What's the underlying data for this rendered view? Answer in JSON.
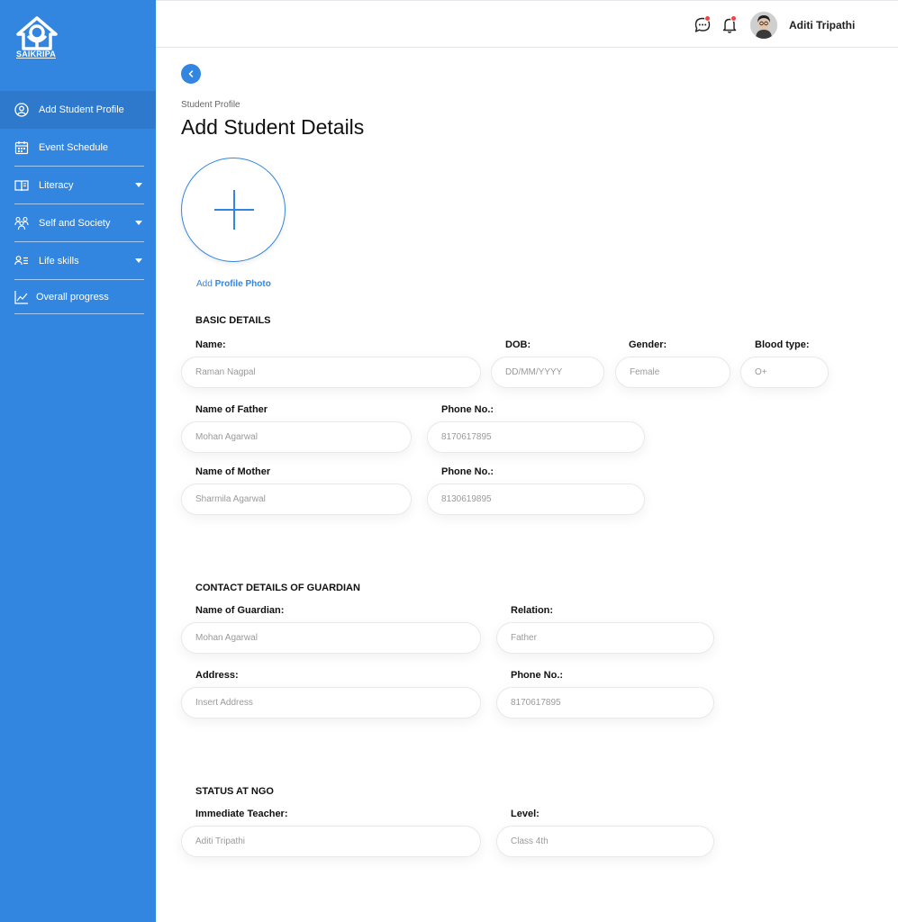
{
  "brand": {
    "logo_text": "SAIKRIPA"
  },
  "sidebar": {
    "items": [
      {
        "label": "Add Student Profile",
        "icon": "user-circle-icon",
        "active": true
      },
      {
        "label": "Event Schedule",
        "icon": "calendar-icon"
      },
      {
        "label": "Literacy",
        "icon": "book-icon",
        "expandable": true
      },
      {
        "label": "Self and Society",
        "icon": "group-icon",
        "expandable": true
      },
      {
        "label": "Life skills",
        "icon": "user-list-icon",
        "expandable": true
      },
      {
        "label": "Overall progress",
        "icon": "chart-line-icon"
      }
    ]
  },
  "header": {
    "user_name": "Aditi Tripathi",
    "icons": [
      "chat-icon",
      "bell-icon"
    ],
    "notification_color": "#ef4444"
  },
  "page": {
    "breadcrumb": "Student Profile",
    "title": "Add Student Details",
    "photo_label_prefix": "Add",
    "photo_label_bold": "Profile Photo"
  },
  "basic": {
    "section": "BASIC DETAILS",
    "name_label": "Name:",
    "name_value": "Raman Nagpal",
    "dob_label": "DOB:",
    "dob_placeholder": "DD/MM/YYYY",
    "gender_label": "Gender:",
    "gender_value": "Female",
    "blood_label": "Blood type:",
    "blood_value": "O+",
    "father_label": "Name of Father",
    "father_value": "Mohan Agarwal",
    "father_phone_label": "Phone No.:",
    "father_phone_value": "8170617895",
    "mother_label": "Name of Mother",
    "mother_value": "Sharmila Agarwal",
    "mother_phone_label": "Phone No.:",
    "mother_phone_value": "8130619895"
  },
  "guardian": {
    "section": "CONTACT DETAILS OF GUARDIAN",
    "name_label": "Name of Guardian:",
    "name_value": "Mohan Agarwal",
    "relation_label": "Relation:",
    "relation_value": "Father",
    "address_label": "Address:",
    "address_placeholder": "Insert Address",
    "phone_label": "Phone No.:",
    "phone_value": "8170617895"
  },
  "status": {
    "section": "STATUS AT NGO",
    "teacher_label": "Immediate Teacher:",
    "teacher_value": "Aditi Tripathi",
    "level_label": "Level:",
    "level_value": "Class 4th"
  },
  "colors": {
    "primary": "#3386e0",
    "primary_dark": "#2e79cc"
  }
}
